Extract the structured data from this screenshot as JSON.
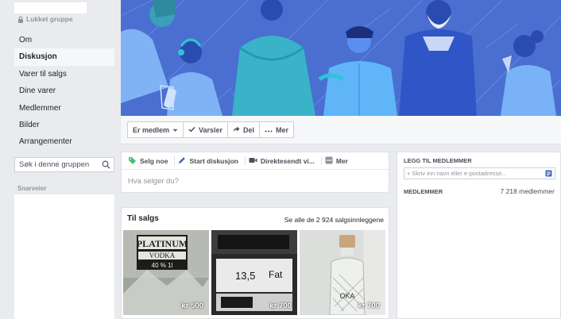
{
  "sidebar": {
    "privacy": "Lukket gruppe",
    "items": [
      {
        "label": "Om"
      },
      {
        "label": "Diskusjon"
      },
      {
        "label": "Varer til salgs"
      },
      {
        "label": "Dine varer"
      },
      {
        "label": "Medlemmer"
      },
      {
        "label": "Bilder"
      },
      {
        "label": "Arrangementer"
      }
    ],
    "search_placeholder": "Søk i denne gruppen",
    "shortcuts_label": "Snarveier"
  },
  "actions": {
    "member_label": "Er medlem",
    "notifications_label": "Varsler",
    "share_label": "Del",
    "more_label": "Mer"
  },
  "composer": {
    "tabs": [
      {
        "label": "Selg noe"
      },
      {
        "label": "Start diskusjon"
      },
      {
        "label": "Direktesendt vi..."
      },
      {
        "label": "Mer"
      }
    ],
    "placeholder": "Hva selger du?"
  },
  "for_sale": {
    "title": "Til salgs",
    "see_all": "Se alle de 2 924 salgsinnleggene",
    "products": [
      {
        "price": "kr 500",
        "label_text": "PLATINUM",
        "sub_text": "VODKA",
        "detail_text": "40 %    1l"
      },
      {
        "price": "kr 700",
        "label_text": "13,5",
        "sub_text": "Fat"
      },
      {
        "price": "kr 700",
        "label_text": "OKA"
      }
    ]
  },
  "right_panel": {
    "add_members_label": "LEGG TIL MEDLEMMER",
    "add_members_placeholder": "+ Skriv inn navn eller e-postadresse...",
    "members_label": "MEDLEMMER",
    "members_count": "7 218 medlemmer"
  },
  "colors": {
    "cover_bg": "#4a6fd1",
    "page_bg": "#e9ebee",
    "link": "#4267b2"
  }
}
